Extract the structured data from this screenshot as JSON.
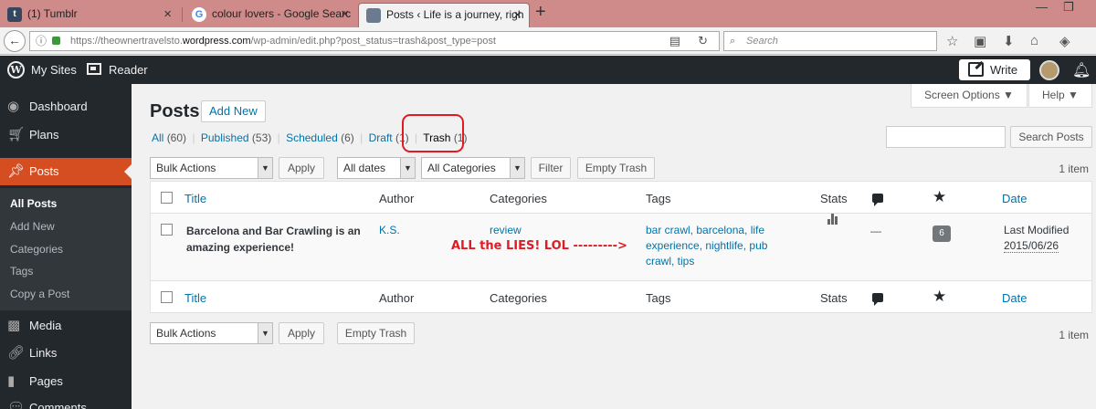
{
  "browser": {
    "tabs": [
      {
        "title": "(1) Tumblr",
        "favicon_color": "#36465d"
      },
      {
        "title": "colour lovers - Google Searc",
        "favicon_color": "#ffffff"
      },
      {
        "title": "Posts ‹ Life is a journey, righ",
        "favicon_color": "#6b7a8f"
      }
    ],
    "url_prefix": "https://theownertravelsto.",
    "url_domain": "wordpress.com",
    "url_path": "/wp-admin/edit.php?post_status=trash&post_type=post",
    "search_placeholder": "Search"
  },
  "adminbar": {
    "my_sites": "My Sites",
    "reader": "Reader",
    "write": "Write",
    "logo_letter": "W"
  },
  "sidebar": {
    "items": [
      {
        "label": "Dashboard",
        "icon": "dashboard-icon"
      },
      {
        "label": "Plans",
        "icon": "cart-icon"
      },
      {
        "label": "Posts",
        "icon": "pin-icon"
      },
      {
        "label": "Media",
        "icon": "media-icon"
      },
      {
        "label": "Links",
        "icon": "link-icon"
      },
      {
        "label": "Pages",
        "icon": "pages-icon"
      },
      {
        "label": "Comments",
        "icon": "comments-icon"
      }
    ],
    "submenu": [
      "All Posts",
      "Add New",
      "Categories",
      "Tags",
      "Copy a Post"
    ]
  },
  "header": {
    "screen_options": "Screen Options ▼",
    "help": "Help ▼",
    "title": "Posts",
    "add_new": "Add New",
    "search_button": "Search Posts"
  },
  "views": {
    "all": "All",
    "all_count": "(60)",
    "published": "Published",
    "published_count": "(53)",
    "scheduled": "Scheduled",
    "scheduled_count": "(6)",
    "draft": "Draft",
    "draft_count": "(1)",
    "trash": "Trash",
    "trash_count": "(1)",
    "sep": "|"
  },
  "filters": {
    "bulk_actions": "Bulk Actions",
    "apply": "Apply",
    "all_dates": "All dates",
    "all_categories": "All Categories",
    "filter": "Filter",
    "empty_trash": "Empty Trash",
    "item_count": "1 item"
  },
  "table": {
    "headers": {
      "title": "Title",
      "author": "Author",
      "categories": "Categories",
      "tags": "Tags",
      "stats": "Stats",
      "date": "Date"
    },
    "row": {
      "title": "Barcelona and Bar Crawling is an amazing experience!",
      "author": "K.S.",
      "category": "review",
      "tags": "bar crawl, barcelona, life experience, nightlife, pub crawl, tips",
      "comments_dash": "—",
      "likes": "6",
      "date_status": "Last Modified",
      "date": "2015/06/26"
    }
  },
  "annotation": "ALL the LIES! LOL --------->",
  "colors": {
    "admin_bar": "#23282d",
    "current_menu": "#d54e21",
    "link": "#0073aa",
    "annotation_red": "#e01b24",
    "browser_tabstrip": "#cf8a8a"
  }
}
